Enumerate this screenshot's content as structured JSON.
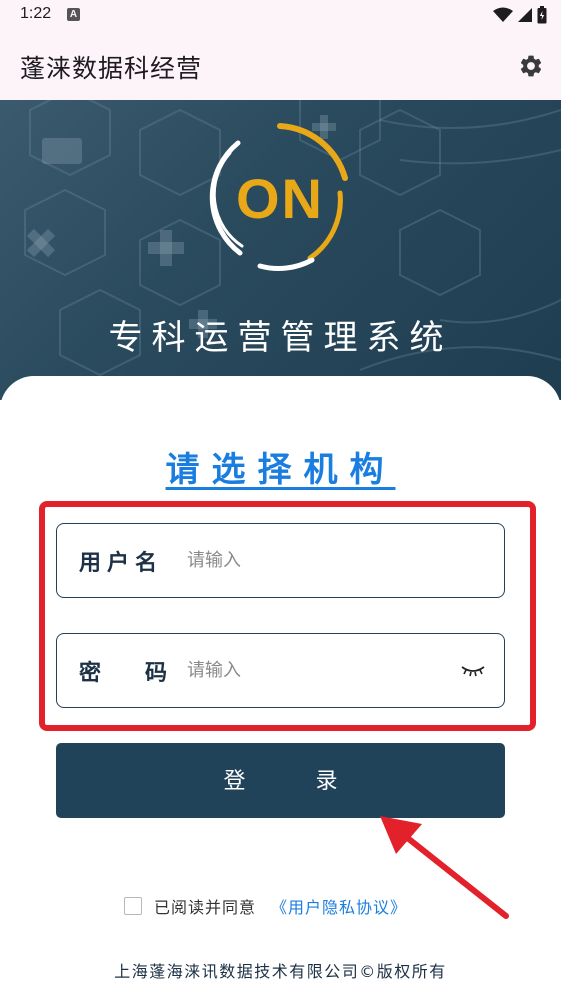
{
  "status_bar": {
    "time": "1:22",
    "notification_letter": "A"
  },
  "app_bar": {
    "title": "蓬涞数据科经营",
    "settings_icon": "gear-icon"
  },
  "banner": {
    "logo_text": "ON",
    "system_name": "专科运营管理系统"
  },
  "login": {
    "select_org": "请选择机构",
    "username": {
      "label": "用户名",
      "placeholder": "请输入"
    },
    "password": {
      "label": "密码",
      "placeholder": "请输入",
      "toggle_icon": "eye-closed-icon"
    },
    "submit_label": "登录"
  },
  "agreement": {
    "text": "已阅读并同意",
    "link": "《用户隐私协议》"
  },
  "footer": {
    "copyright": "上海蓬海涞讯数据技术有限公司©版权所有"
  },
  "colors": {
    "primary": "#20435a",
    "link": "#1a7ee0",
    "highlight": "#e2212a",
    "logo_accent": "#e8a817"
  }
}
